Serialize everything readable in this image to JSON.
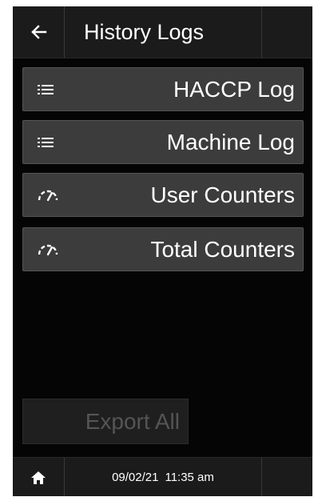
{
  "header": {
    "back_icon": "arrow-left-icon",
    "title": "History Logs"
  },
  "menu": {
    "items": [
      {
        "label": "HACCP Log",
        "icon": "list-icon"
      },
      {
        "label": "Machine Log",
        "icon": "list-icon"
      },
      {
        "label": "User Counters",
        "icon": "gauge-icon"
      },
      {
        "label": "Total Counters",
        "icon": "gauge-icon"
      }
    ]
  },
  "export": {
    "label": "Export All",
    "enabled": false
  },
  "footer": {
    "home_icon": "home-icon",
    "date": "09/02/21",
    "time": "11:35 am"
  },
  "colors": {
    "background": "#050505",
    "bar": "#1b1b1b",
    "button": "#3c3c3c",
    "text": "#ffffff",
    "disabled_text": "#555555"
  }
}
